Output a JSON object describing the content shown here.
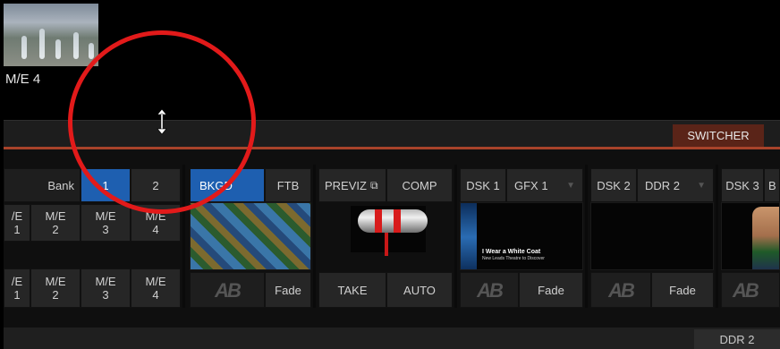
{
  "thumbnail": {
    "label": "M/E 4"
  },
  "tabs": {
    "switcher": "SWITCHER",
    "ddr2": "DDR 2"
  },
  "bank": {
    "label": "Bank",
    "b1": "1",
    "b2": "2"
  },
  "me_row1": [
    {
      "l1": "/E",
      "l2": "1"
    },
    {
      "l1": "M/E",
      "l2": "2"
    },
    {
      "l1": "M/E",
      "l2": "3"
    },
    {
      "l1": "M/E",
      "l2": "4"
    }
  ],
  "me_row2": [
    {
      "l1": "/E",
      "l2": "1"
    },
    {
      "l1": "M/E",
      "l2": "2"
    },
    {
      "l1": "M/E",
      "l2": "3"
    },
    {
      "l1": "M/E",
      "l2": "4"
    }
  ],
  "bkgd": {
    "label": "BKGD",
    "ftb": "FTB",
    "fade": "Fade"
  },
  "transition": {
    "previz": "PREVIZ",
    "comp": "COMP",
    "take": "TAKE",
    "auto": "AUTO"
  },
  "dsk1": {
    "label": "DSK 1",
    "source": "GFX 1",
    "fade": "Fade",
    "title": "I Wear a White Coat",
    "subtitle": "New Leads Theatre to Discover"
  },
  "dsk2": {
    "label": "DSK 2",
    "source": "DDR 2",
    "fade": "Fade"
  },
  "dsk3": {
    "label": "DSK 3",
    "source": "B"
  },
  "colors": {
    "accent_blue": "#1e5fb0",
    "accent_red": "#a8432a",
    "annotation_red": "#e21a1a"
  }
}
